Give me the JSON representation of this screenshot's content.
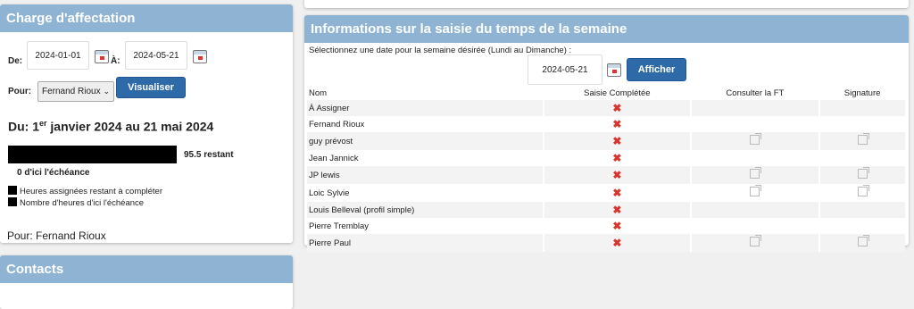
{
  "charge": {
    "title": "Charge d'affectation",
    "from_label": "De:",
    "from_value": "2024-01-01",
    "to_label": "À:",
    "to_value": "2024-05-21",
    "pour_label": "Pour:",
    "pour_select": "Fernand Rioux",
    "visualize_button": "Visualiser",
    "range_prefix": "Du: 1",
    "range_sup": "er",
    "range_suffix": " janvier 2024 au 21 mai 2024",
    "remaining_label": "95.5 restant",
    "deadline_label": "0 d'ici l'échéance",
    "legend": [
      "Heures assignées restant à compléter",
      "Nombre d'heures d'ici l'échéance"
    ],
    "pour_footer": "Pour: Fernand Rioux"
  },
  "contacts": {
    "title": "Contacts"
  },
  "week": {
    "title": "Informations sur la saisie du temps de la semaine",
    "instruction": "Sélectionnez une date pour la semaine désirée (Lundi au Dimanche) :",
    "date_value": "2024-05-21",
    "show_button": "Afficher",
    "columns": [
      "Nom",
      "Saisie Complétée",
      "Consulter la FT",
      "Signature"
    ],
    "rows": [
      {
        "name": "À Assigner",
        "completed": false,
        "links": false
      },
      {
        "name": "Fernand Rioux",
        "completed": false,
        "links": false
      },
      {
        "name": "guy prévost",
        "completed": false,
        "links": true
      },
      {
        "name": "Jean Jannick",
        "completed": false,
        "links": false
      },
      {
        "name": "JP lewis",
        "completed": false,
        "links": true
      },
      {
        "name": "Loic Sylvie",
        "completed": false,
        "links": true
      },
      {
        "name": "Louis Belleval (profil simple)",
        "completed": false,
        "links": false
      },
      {
        "name": "Pierre Tremblay",
        "completed": false,
        "links": false
      },
      {
        "name": "Pierre Paul",
        "completed": false,
        "links": true
      }
    ]
  }
}
